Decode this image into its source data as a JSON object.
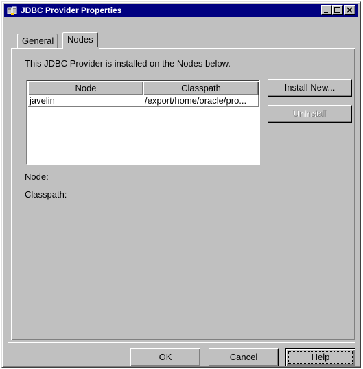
{
  "window": {
    "title": "JDBC Provider Properties",
    "title_icon": "jdbc-provider-icon",
    "controls": [
      "minimize-icon",
      "maximize-icon",
      "close-icon"
    ]
  },
  "tabs": [
    {
      "label": "General",
      "selected": false
    },
    {
      "label": "Nodes",
      "selected": true
    }
  ],
  "nodes_panel": {
    "description": "This JDBC Provider is installed on the Nodes below.",
    "table": {
      "columns": [
        "Node",
        "Classpath"
      ],
      "rows": [
        {
          "node": "javelin",
          "classpath": "/export/home/oracle/pro..."
        }
      ]
    },
    "buttons": {
      "install_new": "Install New...",
      "uninstall": "Uninstall"
    },
    "node_label": "Node:",
    "classpath_label": "Classpath:"
  },
  "footer": {
    "ok": "OK",
    "cancel": "Cancel",
    "help": "Help"
  },
  "colors": {
    "titlebar": "#000080",
    "face": "#c0c0c0",
    "disabled_text": "#808080"
  }
}
